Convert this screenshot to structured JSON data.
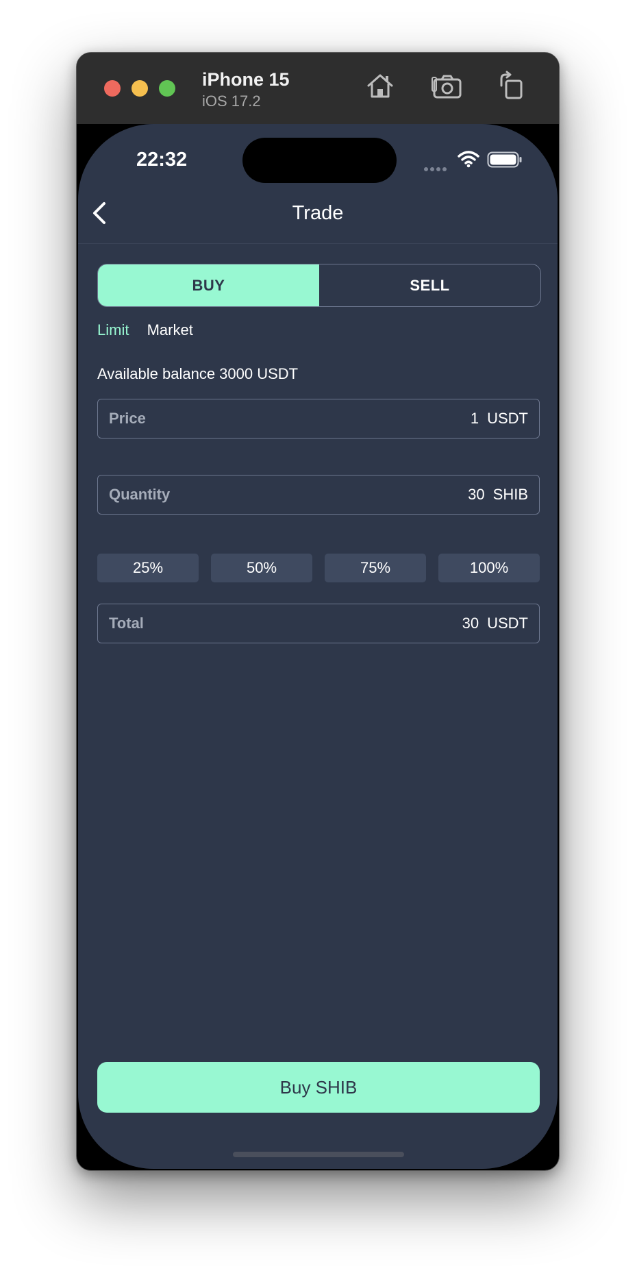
{
  "simulator": {
    "device_name": "iPhone 15",
    "os_version": "iOS 17.2",
    "toolbar_icons": [
      "home-icon",
      "screenshot-icon",
      "rotate-icon"
    ]
  },
  "status_bar": {
    "time": "22:32",
    "icons": [
      "cellular-signal-icon",
      "wifi-icon",
      "battery-icon"
    ]
  },
  "navbar": {
    "title": "Trade",
    "back_icon": "chevron-left-icon"
  },
  "side_toggle": {
    "buy_label": "BUY",
    "sell_label": "SELL",
    "selected": "BUY"
  },
  "order_type": {
    "limit_label": "Limit",
    "market_label": "Market",
    "selected": "Limit"
  },
  "balance_text": "Available balance 3000 USDT",
  "fields": {
    "price": {
      "label": "Price",
      "value": "1",
      "unit": "USDT"
    },
    "quantity": {
      "label": "Quantity",
      "value": "30",
      "unit": "SHIB"
    },
    "total": {
      "label": "Total",
      "value": "30",
      "unit": "USDT"
    }
  },
  "percent_buttons": [
    "25%",
    "50%",
    "75%",
    "100%"
  ],
  "action_button": {
    "label": "Buy SHIB"
  },
  "colors": {
    "accent": "#98f8d2",
    "background": "#2e374a",
    "chip": "#3f4a60",
    "border": "#6e7890"
  }
}
